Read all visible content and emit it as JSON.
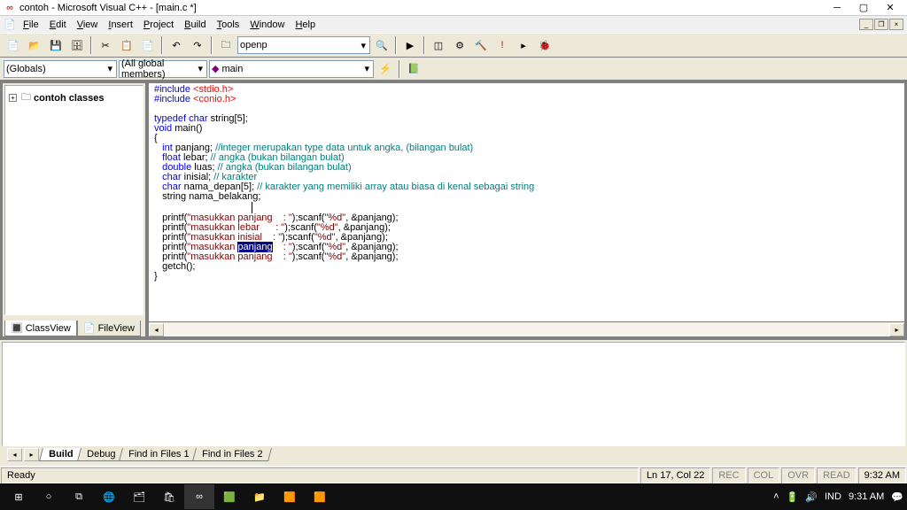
{
  "window": {
    "title": "contoh - Microsoft Visual C++ - [main.c *]"
  },
  "menu": {
    "items": [
      "File",
      "Edit",
      "View",
      "Insert",
      "Project",
      "Build",
      "Tools",
      "Window",
      "Help"
    ]
  },
  "toolbar1": {
    "search_value": "openp"
  },
  "toolbar2": {
    "scope": "(Globals)",
    "members": "(All global members)",
    "func": "main"
  },
  "left_panel": {
    "tree_root": "contoh classes",
    "tabs": [
      "ClassView",
      "FileView"
    ],
    "active_tab": 0
  },
  "code": {
    "lines": [
      {
        "t": [
          [
            "kw-blue",
            "#include "
          ],
          [
            "kw-red",
            "<stdio.h>"
          ]
        ]
      },
      {
        "t": [
          [
            "kw-blue",
            "#include "
          ],
          [
            "kw-red",
            "<conio.h>"
          ]
        ]
      },
      {
        "t": [
          [
            "",
            ""
          ]
        ]
      },
      {
        "t": [
          [
            "kw-blue",
            "typedef "
          ],
          [
            "kw-blue",
            "char "
          ],
          [
            "",
            "string"
          ],
          [
            "",
            "[5];"
          ]
        ]
      },
      {
        "t": [
          [
            "kw-blue",
            "void "
          ],
          [
            "",
            "main"
          ],
          [
            "",
            "()"
          ]
        ]
      },
      {
        "t": [
          [
            "",
            "{"
          ]
        ]
      },
      {
        "t": [
          [
            "",
            "   "
          ],
          [
            "kw-blue",
            "int "
          ],
          [
            "",
            "panjang; "
          ],
          [
            "kw-teal",
            "//integer merupakan type data untuk angka, (bilangan bulat)"
          ]
        ]
      },
      {
        "t": [
          [
            "",
            "   "
          ],
          [
            "kw-blue",
            "float "
          ],
          [
            "",
            "lebar; "
          ],
          [
            "kw-teal",
            "// angka (bukan bilangan bulat)"
          ]
        ]
      },
      {
        "t": [
          [
            "",
            "   "
          ],
          [
            "kw-blue",
            "double "
          ],
          [
            "",
            "luas; "
          ],
          [
            "kw-teal",
            "// angka (bukan bilangan bulat)"
          ]
        ]
      },
      {
        "t": [
          [
            "",
            "   "
          ],
          [
            "kw-blue",
            "char "
          ],
          [
            "",
            "inisial; "
          ],
          [
            "kw-teal",
            "// karakter"
          ]
        ]
      },
      {
        "t": [
          [
            "",
            "   "
          ],
          [
            "kw-blue",
            "char "
          ],
          [
            "",
            "nama_depan[5]; "
          ],
          [
            "kw-teal",
            "// karakter yang memiliki array atau biasa di kenal sebagai string"
          ]
        ]
      },
      {
        "t": [
          [
            "",
            "   string nama_belakang;"
          ]
        ]
      },
      {
        "t": [
          [
            "",
            "                                    "
          ],
          [
            "cursor",
            ""
          ]
        ]
      },
      {
        "t": [
          [
            "",
            "   printf"
          ],
          [
            "",
            "("
          ],
          [
            "kw-str",
            "\"masukkan panjang    : \""
          ],
          [
            "",
            ");scanf("
          ],
          [
            "kw-str",
            "\"%d\""
          ],
          [
            "",
            ", &panjang);"
          ]
        ]
      },
      {
        "t": [
          [
            "",
            "   printf"
          ],
          [
            "",
            "("
          ],
          [
            "kw-str",
            "\"masukkan lebar      : \""
          ],
          [
            "",
            ");scanf("
          ],
          [
            "kw-str",
            "\"%d\""
          ],
          [
            "",
            ", &panjang);"
          ]
        ]
      },
      {
        "t": [
          [
            "",
            "   printf"
          ],
          [
            "",
            "("
          ],
          [
            "kw-str",
            "\"masukkan inisial    : \""
          ],
          [
            "",
            ");scanf("
          ],
          [
            "kw-str",
            "\"%d\""
          ],
          [
            "",
            ", &panjang);"
          ]
        ]
      },
      {
        "t": [
          [
            "",
            "   printf"
          ],
          [
            "",
            "("
          ],
          [
            "kw-str",
            "\"masukkan "
          ],
          [
            "sel",
            "panjang"
          ],
          [
            "kw-str",
            "    : \""
          ],
          [
            "",
            ");scanf("
          ],
          [
            "kw-str",
            "\"%d\""
          ],
          [
            "",
            ", &panjang);"
          ]
        ]
      },
      {
        "t": [
          [
            "",
            "   printf"
          ],
          [
            "",
            "("
          ],
          [
            "kw-str",
            "\"masukkan panjang    : \""
          ],
          [
            "",
            ");scanf("
          ],
          [
            "kw-str",
            "\"%d\""
          ],
          [
            "",
            ", &panjang);"
          ]
        ]
      },
      {
        "t": [
          [
            "",
            "   getch();"
          ]
        ]
      },
      {
        "t": [
          [
            "",
            "}"
          ]
        ]
      }
    ]
  },
  "output": {
    "tabs": [
      "Build",
      "Debug",
      "Find in Files 1",
      "Find in Files 2"
    ],
    "active_tab": 0
  },
  "status": {
    "ready": "Ready",
    "cursor": "Ln 17, Col 22",
    "indicators": [
      "REC",
      "COL",
      "OVR",
      "READ"
    ],
    "time_right": "9:32 AM"
  },
  "taskbar": {
    "tray": {
      "lang": "IND",
      "time": "9:31 AM"
    }
  }
}
